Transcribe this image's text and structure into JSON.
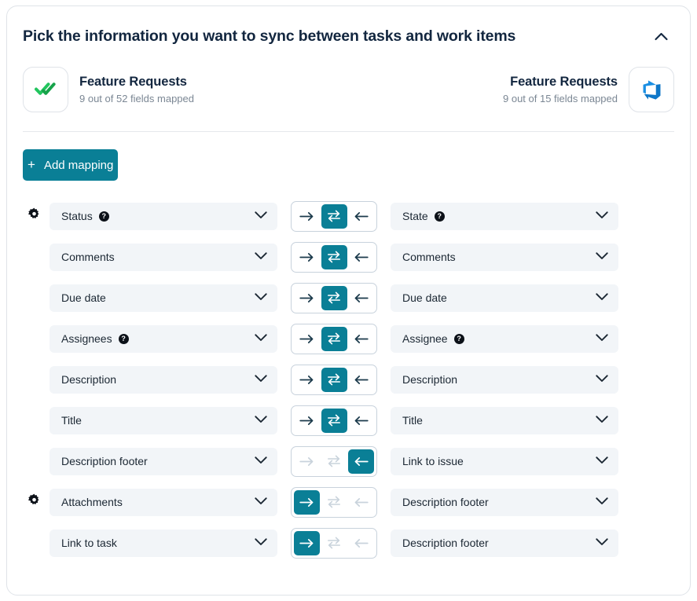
{
  "header": {
    "title": "Pick the information you want to sync between tasks and work items",
    "collapse_icon": "chevron-up-icon"
  },
  "connectors": {
    "left": {
      "icon": "todoist-double-check-icon",
      "name": "Feature Requests",
      "fields_mapped": "9 out of 52 fields mapped"
    },
    "right": {
      "icon": "azure-devops-icon",
      "name": "Feature Requests",
      "fields_mapped": "9 out of 15 fields mapped"
    }
  },
  "toolbar": {
    "add_mapping_label": "Add mapping",
    "add_mapping_icon": "plus-icon",
    "accent_color": "#0a7f96"
  },
  "mappings": [
    {
      "settings_icon": true,
      "left_field": "Status",
      "left_help": true,
      "direction": "both",
      "right_field": "State",
      "right_help": true
    },
    {
      "settings_icon": false,
      "left_field": "Comments",
      "left_help": false,
      "direction": "both",
      "right_field": "Comments",
      "right_help": false
    },
    {
      "settings_icon": false,
      "left_field": "Due date",
      "left_help": false,
      "direction": "both",
      "right_field": "Due date",
      "right_help": false
    },
    {
      "settings_icon": false,
      "left_field": "Assignees",
      "left_help": true,
      "direction": "both",
      "right_field": "Assignee",
      "right_help": true
    },
    {
      "settings_icon": false,
      "left_field": "Description",
      "left_help": false,
      "direction": "both",
      "right_field": "Description",
      "right_help": false
    },
    {
      "settings_icon": false,
      "left_field": "Title",
      "left_help": false,
      "direction": "both",
      "right_field": "Title",
      "right_help": false
    },
    {
      "settings_icon": false,
      "left_field": "Description footer",
      "left_help": false,
      "direction": "left",
      "right_field": "Link to issue",
      "right_help": false
    },
    {
      "settings_icon": true,
      "left_field": "Attachments",
      "left_help": false,
      "direction": "right",
      "right_field": "Description footer",
      "right_help": false
    },
    {
      "settings_icon": false,
      "left_field": "Link to task",
      "left_help": false,
      "direction": "right",
      "right_field": "Description footer",
      "right_help": false
    }
  ],
  "icons": {
    "settings": "gear-icon",
    "dropdown": "chevron-down-icon",
    "direction_right": "arrow-right-icon",
    "direction_both": "arrows-bidirectional-icon",
    "direction_left": "arrow-left-icon",
    "help": "?"
  }
}
